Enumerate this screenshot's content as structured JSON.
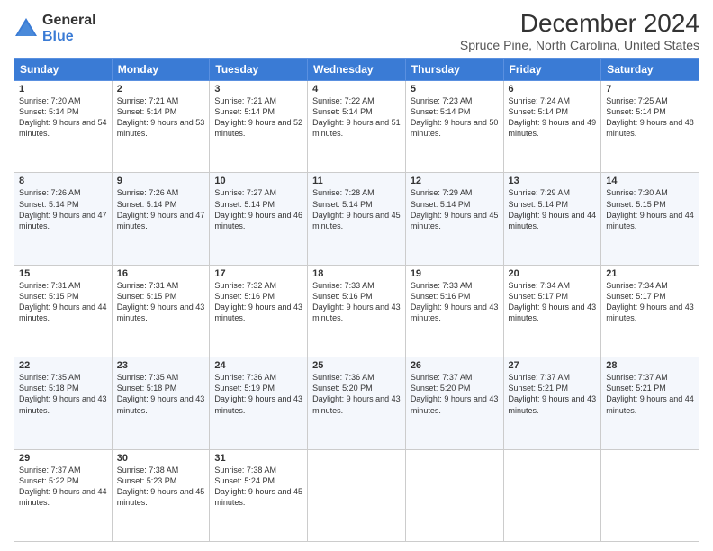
{
  "logo": {
    "general": "General",
    "blue": "Blue"
  },
  "header": {
    "title": "December 2024",
    "subtitle": "Spruce Pine, North Carolina, United States"
  },
  "columns": [
    "Sunday",
    "Monday",
    "Tuesday",
    "Wednesday",
    "Thursday",
    "Friday",
    "Saturday"
  ],
  "weeks": [
    [
      {
        "day": "1",
        "sunrise": "7:20 AM",
        "sunset": "5:14 PM",
        "daylight": "9 hours and 54 minutes."
      },
      {
        "day": "2",
        "sunrise": "7:21 AM",
        "sunset": "5:14 PM",
        "daylight": "9 hours and 53 minutes."
      },
      {
        "day": "3",
        "sunrise": "7:21 AM",
        "sunset": "5:14 PM",
        "daylight": "9 hours and 52 minutes."
      },
      {
        "day": "4",
        "sunrise": "7:22 AM",
        "sunset": "5:14 PM",
        "daylight": "9 hours and 51 minutes."
      },
      {
        "day": "5",
        "sunrise": "7:23 AM",
        "sunset": "5:14 PM",
        "daylight": "9 hours and 50 minutes."
      },
      {
        "day": "6",
        "sunrise": "7:24 AM",
        "sunset": "5:14 PM",
        "daylight": "9 hours and 49 minutes."
      },
      {
        "day": "7",
        "sunrise": "7:25 AM",
        "sunset": "5:14 PM",
        "daylight": "9 hours and 48 minutes."
      }
    ],
    [
      {
        "day": "8",
        "sunrise": "7:26 AM",
        "sunset": "5:14 PM",
        "daylight": "9 hours and 47 minutes."
      },
      {
        "day": "9",
        "sunrise": "7:26 AM",
        "sunset": "5:14 PM",
        "daylight": "9 hours and 47 minutes."
      },
      {
        "day": "10",
        "sunrise": "7:27 AM",
        "sunset": "5:14 PM",
        "daylight": "9 hours and 46 minutes."
      },
      {
        "day": "11",
        "sunrise": "7:28 AM",
        "sunset": "5:14 PM",
        "daylight": "9 hours and 45 minutes."
      },
      {
        "day": "12",
        "sunrise": "7:29 AM",
        "sunset": "5:14 PM",
        "daylight": "9 hours and 45 minutes."
      },
      {
        "day": "13",
        "sunrise": "7:29 AM",
        "sunset": "5:14 PM",
        "daylight": "9 hours and 44 minutes."
      },
      {
        "day": "14",
        "sunrise": "7:30 AM",
        "sunset": "5:15 PM",
        "daylight": "9 hours and 44 minutes."
      }
    ],
    [
      {
        "day": "15",
        "sunrise": "7:31 AM",
        "sunset": "5:15 PM",
        "daylight": "9 hours and 44 minutes."
      },
      {
        "day": "16",
        "sunrise": "7:31 AM",
        "sunset": "5:15 PM",
        "daylight": "9 hours and 43 minutes."
      },
      {
        "day": "17",
        "sunrise": "7:32 AM",
        "sunset": "5:16 PM",
        "daylight": "9 hours and 43 minutes."
      },
      {
        "day": "18",
        "sunrise": "7:33 AM",
        "sunset": "5:16 PM",
        "daylight": "9 hours and 43 minutes."
      },
      {
        "day": "19",
        "sunrise": "7:33 AM",
        "sunset": "5:16 PM",
        "daylight": "9 hours and 43 minutes."
      },
      {
        "day": "20",
        "sunrise": "7:34 AM",
        "sunset": "5:17 PM",
        "daylight": "9 hours and 43 minutes."
      },
      {
        "day": "21",
        "sunrise": "7:34 AM",
        "sunset": "5:17 PM",
        "daylight": "9 hours and 43 minutes."
      }
    ],
    [
      {
        "day": "22",
        "sunrise": "7:35 AM",
        "sunset": "5:18 PM",
        "daylight": "9 hours and 43 minutes."
      },
      {
        "day": "23",
        "sunrise": "7:35 AM",
        "sunset": "5:18 PM",
        "daylight": "9 hours and 43 minutes."
      },
      {
        "day": "24",
        "sunrise": "7:36 AM",
        "sunset": "5:19 PM",
        "daylight": "9 hours and 43 minutes."
      },
      {
        "day": "25",
        "sunrise": "7:36 AM",
        "sunset": "5:20 PM",
        "daylight": "9 hours and 43 minutes."
      },
      {
        "day": "26",
        "sunrise": "7:37 AM",
        "sunset": "5:20 PM",
        "daylight": "9 hours and 43 minutes."
      },
      {
        "day": "27",
        "sunrise": "7:37 AM",
        "sunset": "5:21 PM",
        "daylight": "9 hours and 43 minutes."
      },
      {
        "day": "28",
        "sunrise": "7:37 AM",
        "sunset": "5:21 PM",
        "daylight": "9 hours and 44 minutes."
      }
    ],
    [
      {
        "day": "29",
        "sunrise": "7:37 AM",
        "sunset": "5:22 PM",
        "daylight": "9 hours and 44 minutes."
      },
      {
        "day": "30",
        "sunrise": "7:38 AM",
        "sunset": "5:23 PM",
        "daylight": "9 hours and 45 minutes."
      },
      {
        "day": "31",
        "sunrise": "7:38 AM",
        "sunset": "5:24 PM",
        "daylight": "9 hours and 45 minutes."
      },
      null,
      null,
      null,
      null
    ]
  ],
  "labels": {
    "sunrise": "Sunrise:",
    "sunset": "Sunset:",
    "daylight": "Daylight:"
  }
}
